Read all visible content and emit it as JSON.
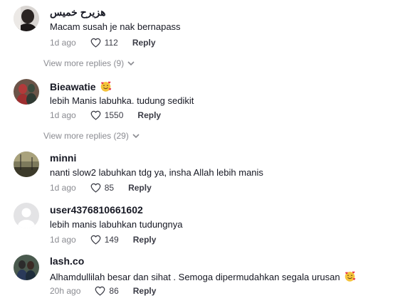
{
  "comments": [
    {
      "username": "هزيرح خميس",
      "text": "Macam susah je nak bernapass",
      "time": "1d ago",
      "likes": "112",
      "reply_label": "Reply"
    },
    {
      "username": "Bieawatie",
      "text": "lebih Manis labuhka. tudung sedikit",
      "time": "1d ago",
      "likes": "1550",
      "reply_label": "Reply"
    },
    {
      "username": "minni",
      "text": "nanti slow2 labuhkan tdg ya, insha Allah lebih manis",
      "time": "1d ago",
      "likes": "85",
      "reply_label": "Reply"
    },
    {
      "username": "user4376810661602",
      "text": "lebih manis labuhkan tudungnya",
      "time": "1d ago",
      "likes": "149",
      "reply_label": "Reply"
    },
    {
      "username": "lash.co",
      "text": "Alhamdullilah besar dan sihat . Semoga dipermudahkan segala urusan",
      "time": "20h ago",
      "likes": "86",
      "reply_label": "Reply"
    }
  ],
  "view_more": [
    {
      "label": "View more replies (9)"
    },
    {
      "label": "View more replies (29)"
    }
  ],
  "icons": {
    "like": "heart-outline-icon",
    "expand": "chevron-down-icon",
    "emoji": "smiling-face-with-hearts-emoji"
  },
  "colors": {
    "text": "#161823",
    "muted": "#8a8b91"
  }
}
